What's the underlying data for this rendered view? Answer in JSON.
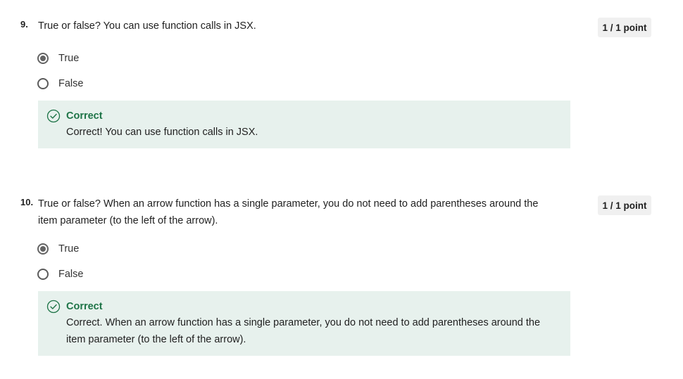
{
  "questions": [
    {
      "number": "9.",
      "text": "True or false? You can use function calls in JSX.",
      "points": "1 / 1 point",
      "options": [
        {
          "label": "True",
          "selected": true
        },
        {
          "label": "False",
          "selected": false
        }
      ],
      "feedback": {
        "title": "Correct",
        "text": "Correct! You can use function calls in JSX."
      }
    },
    {
      "number": "10.",
      "text": "True or false? When an arrow function has a single parameter, you do not need to add parentheses around the item parameter (to the left of the arrow).",
      "points": "1 / 1 point",
      "options": [
        {
          "label": "True",
          "selected": true
        },
        {
          "label": "False",
          "selected": false
        }
      ],
      "feedback": {
        "title": "Correct",
        "text": "Correct. When an arrow function has a single parameter, you do not need to add parentheses around the item parameter (to the left of the arrow)."
      }
    }
  ],
  "colors": {
    "feedback_bg": "#e7f1ed",
    "correct_green": "#1e7447",
    "badge_bg": "#f0f0f0"
  },
  "icons": {
    "feedback": "check-circle-icon"
  }
}
